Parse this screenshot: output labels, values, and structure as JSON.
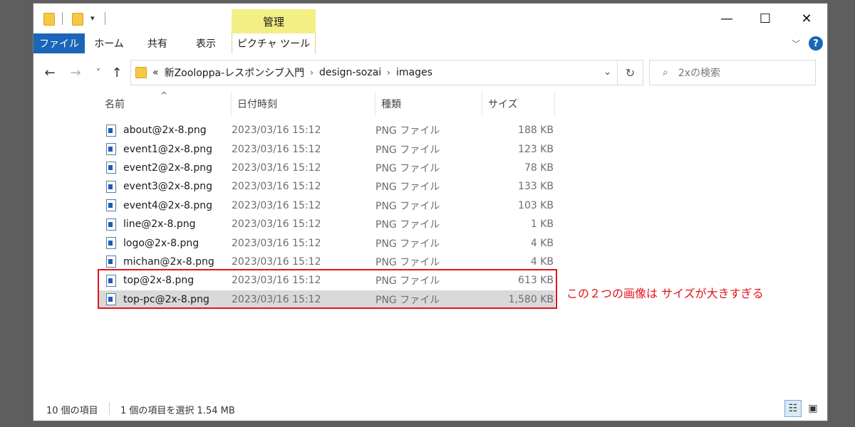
{
  "ribbon": {
    "context_header": "管理",
    "tabs": [
      "ファイル",
      "ホーム",
      "共有",
      "表示",
      "ピクチャ ツール"
    ]
  },
  "window_controls": {
    "minimize": "—",
    "maximize": "☐",
    "close": "✕"
  },
  "address": {
    "prefix": "«",
    "crumbs": [
      "新Zooloppa-レスポンシブ入門",
      "design-sozai",
      "images"
    ],
    "separator": "›"
  },
  "search": {
    "placeholder": "2xの検索"
  },
  "columns": {
    "name": "名前",
    "date": "日付時刻",
    "type": "種類",
    "size": "サイズ"
  },
  "files": [
    {
      "name": "about@2x-8.png",
      "date": "2023/03/16 15:12",
      "type": "PNG ファイル",
      "size": "188 KB"
    },
    {
      "name": "event1@2x-8.png",
      "date": "2023/03/16 15:12",
      "type": "PNG ファイル",
      "size": "123 KB"
    },
    {
      "name": "event2@2x-8.png",
      "date": "2023/03/16 15:12",
      "type": "PNG ファイル",
      "size": "78 KB"
    },
    {
      "name": "event3@2x-8.png",
      "date": "2023/03/16 15:12",
      "type": "PNG ファイル",
      "size": "133 KB"
    },
    {
      "name": "event4@2x-8.png",
      "date": "2023/03/16 15:12",
      "type": "PNG ファイル",
      "size": "103 KB"
    },
    {
      "name": "line@2x-8.png",
      "date": "2023/03/16 15:12",
      "type": "PNG ファイル",
      "size": "1 KB"
    },
    {
      "name": "logo@2x-8.png",
      "date": "2023/03/16 15:12",
      "type": "PNG ファイル",
      "size": "4 KB"
    },
    {
      "name": "michan@2x-8.png",
      "date": "2023/03/16 15:12",
      "type": "PNG ファイル",
      "size": "4 KB"
    },
    {
      "name": "top@2x-8.png",
      "date": "2023/03/16 15:12",
      "type": "PNG ファイル",
      "size": "613 KB"
    },
    {
      "name": "top-pc@2x-8.png",
      "date": "2023/03/16 15:12",
      "type": "PNG ファイル",
      "size": "1,580 KB"
    }
  ],
  "annotation": {
    "text": "この２つの画像は サイズが大きすぎる",
    "color": "#e0141c"
  },
  "status": {
    "count": "10 個の項目",
    "selection": "1 個の項目を選択  1.54 MB"
  },
  "colors": {
    "accent": "#1a66b8",
    "context_tab": "#f3ef85",
    "folder": "#f6c944"
  }
}
